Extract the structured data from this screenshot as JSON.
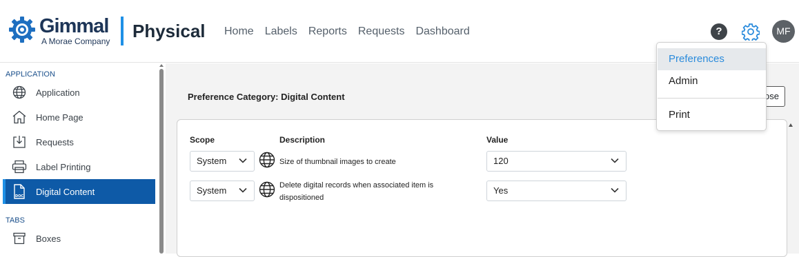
{
  "header": {
    "logo_name": "Gimmal",
    "logo_sub": "A Morae Company",
    "product": "Physical",
    "nav": [
      "Home",
      "Labels",
      "Reports",
      "Requests",
      "Dashboard"
    ],
    "help_label": "?",
    "avatar_initials": "MF"
  },
  "sidebar": {
    "section_application": "APPLICATION",
    "section_tabs": "TABS",
    "items": [
      {
        "label": "Application",
        "icon": "globe-icon"
      },
      {
        "label": "Home Page",
        "icon": "home-icon"
      },
      {
        "label": "Requests",
        "icon": "download-box-icon"
      },
      {
        "label": "Label Printing",
        "icon": "printer-icon"
      },
      {
        "label": "Digital Content",
        "icon": "doc-file-icon",
        "active": true
      },
      {
        "label": "Boxes",
        "icon": "archive-box-icon"
      }
    ]
  },
  "main": {
    "title": "Preference Category: Digital Content",
    "close_label": "ose",
    "columns": {
      "scope": "Scope",
      "description": "Description",
      "value": "Value"
    },
    "rows": [
      {
        "scope": "System",
        "description": "Size of thumbnail images to create",
        "value": "120"
      },
      {
        "scope": "System",
        "description_line1": "Delete digital records when associated item is",
        "description_line2": "dispositioned",
        "value": "Yes"
      }
    ]
  },
  "menu": {
    "items": [
      "Preferences",
      "Admin",
      "Print"
    ]
  },
  "colors": {
    "brand_navy": "#1d3557",
    "accent_blue": "#1e90e6",
    "active_bg": "#0e5aa7"
  }
}
